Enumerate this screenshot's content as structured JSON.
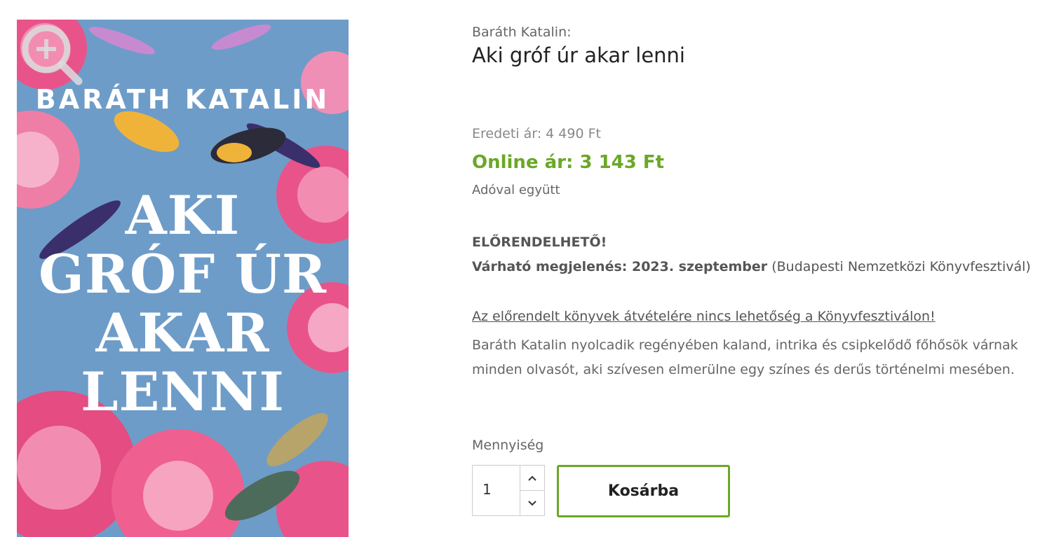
{
  "cover": {
    "author": "BARÁTH KATALIN",
    "title_lines": [
      "AKI",
      "GRÓF ÚR",
      "AKAR",
      "LENNI"
    ]
  },
  "product": {
    "author": "Baráth Katalin:",
    "title": "Aki gróf úr akar lenni",
    "original_price": "Eredeti ár: 4 490 Ft",
    "online_price": "Online ár: 3 143 Ft",
    "tax_note": "Adóval együtt",
    "preorder": "ELŐRENDELHETŐ!",
    "release_label": "Várható megjelenés: 2023. szeptember",
    "release_note": " (Budapesti Nemzetközi Könyvfesztivál)",
    "notice": "Az előrendelt könyvek átvételére nincs lehetőség a Könyvfesztiválon!",
    "description": "Baráth Katalin nyolcadik regényében kaland, intrika és csipkelődő főhősök várnak minden olvasót, aki szívesen elmerülne egy színes és derűs történelmi mesében."
  },
  "purchase": {
    "quantity_label": "Mennyiség",
    "quantity_value": "1",
    "cart_button": "Kosárba"
  },
  "colors": {
    "accent_green": "#6aa827",
    "cover_blue": "#6e9cc8",
    "flower_pink": "#e8548a"
  },
  "icons": [
    "zoom-icon",
    "chevron-up-icon",
    "chevron-down-icon"
  ]
}
